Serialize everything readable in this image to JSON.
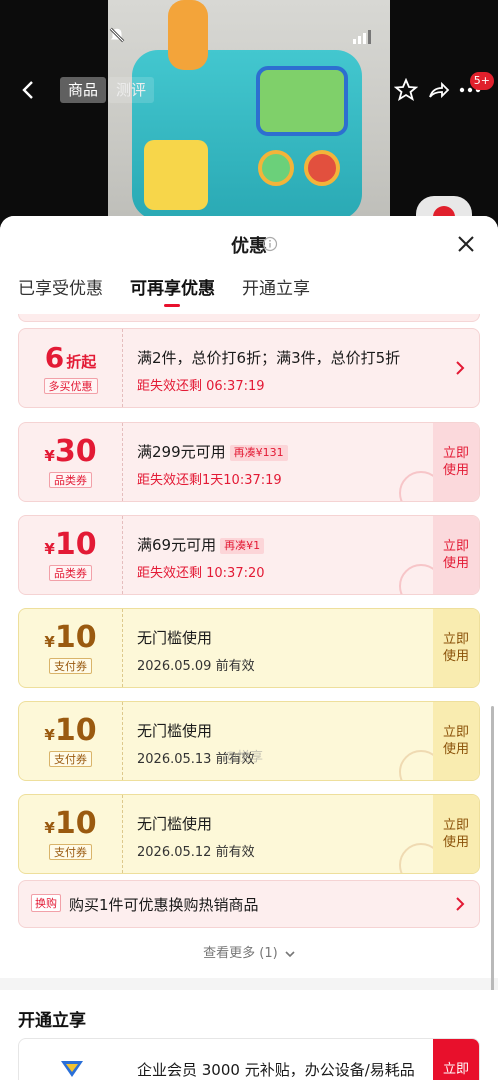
{
  "topbar": {
    "tabs": [
      "商品",
      "测评"
    ],
    "cart_badge": "5+"
  },
  "sheet": {
    "title": "优惠",
    "tabs": [
      "已享受优惠",
      "可再享优惠",
      "开通立享"
    ],
    "active_tab_index": 1,
    "discount": {
      "value": "6",
      "suffix": "折起",
      "tag": "多买优惠",
      "title": "满2件，总价打6折；满3件，总价打5折",
      "sub": "距失效还剩 06:37:19"
    },
    "coupons": [
      {
        "yen": "¥",
        "value": "30",
        "tag": "品类券",
        "title": "满299元可用",
        "extra": "再凑¥131",
        "sub": "距失效还剩1天10:37:19",
        "action": "立即\n使用",
        "theme": "pink"
      },
      {
        "yen": "¥",
        "value": "10",
        "tag": "品类券",
        "title": "满69元可用",
        "extra": "再凑¥1",
        "sub": "距失效还剩 10:37:20",
        "action": "立即\n使用",
        "theme": "pink"
      },
      {
        "yen": "¥",
        "value": "10",
        "tag": "支付券",
        "title": "无门槛使用",
        "extra": "",
        "sub": "2026.05.09 前有效",
        "action": "立即\n使用",
        "theme": "yellow"
      },
      {
        "yen": "¥",
        "value": "10",
        "tag": "支付券",
        "title": "无门槛使用",
        "extra": "",
        "sub": "2026.05.13 前有效",
        "action": "立即\n使用",
        "theme": "yellow"
      },
      {
        "yen": "¥",
        "value": "10",
        "tag": "支付券",
        "title": "无门槛使用",
        "extra": "",
        "sub": "2026.05.12 前有效",
        "action": "立即\n使用",
        "theme": "yellow"
      }
    ],
    "exchange": {
      "tag": "换购",
      "text": "购买1件可优惠换购热销商品"
    },
    "see_more": "查看更多 (1)",
    "section2": {
      "title": "开通立享",
      "member_text": "企业会员 3000 元补贴，办公设备/易耗品",
      "member_action": "立即"
    },
    "watermark": "@悦享"
  },
  "colors": {
    "accent": "#e8102c",
    "coupon_pink": "#fdeeee",
    "coupon_yellow": "#fdf8d8"
  }
}
